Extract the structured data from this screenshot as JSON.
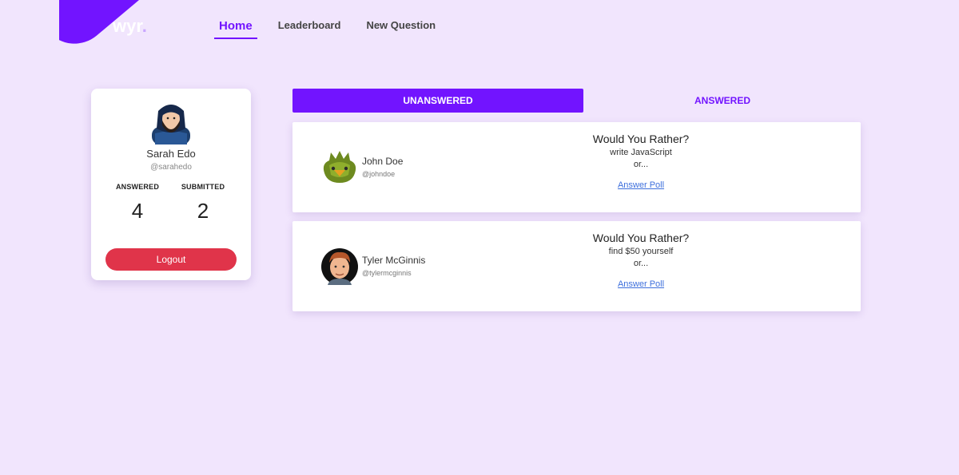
{
  "brand": {
    "logo_text": "wyr",
    "logo_fade": ".",
    "accent": "#7214ff"
  },
  "nav": {
    "items": [
      {
        "label": "Home",
        "active": true
      },
      {
        "label": "Leaderboard",
        "active": false
      },
      {
        "label": "New Question",
        "active": false
      }
    ]
  },
  "profile": {
    "name": "Sarah Edo",
    "handle": "@sarahedo",
    "answered_label": "ANSWERED",
    "answered_value": "4",
    "submitted_label": "SUBMITTED",
    "submitted_value": "2",
    "logout_label": "Logout"
  },
  "tabs": {
    "unanswered": "UNANSWERED",
    "answered": "ANSWERED"
  },
  "questions": [
    {
      "author": "John Doe",
      "handle": "@johndoe",
      "title": "Would You Rather?",
      "option": "write JavaScript",
      "or": "or...",
      "link": "Answer Poll"
    },
    {
      "author": "Tyler McGinnis",
      "handle": "@tylermcginnis",
      "title": "Would You Rather?",
      "option": "find $50 yourself",
      "or": "or...",
      "link": "Answer Poll"
    }
  ]
}
